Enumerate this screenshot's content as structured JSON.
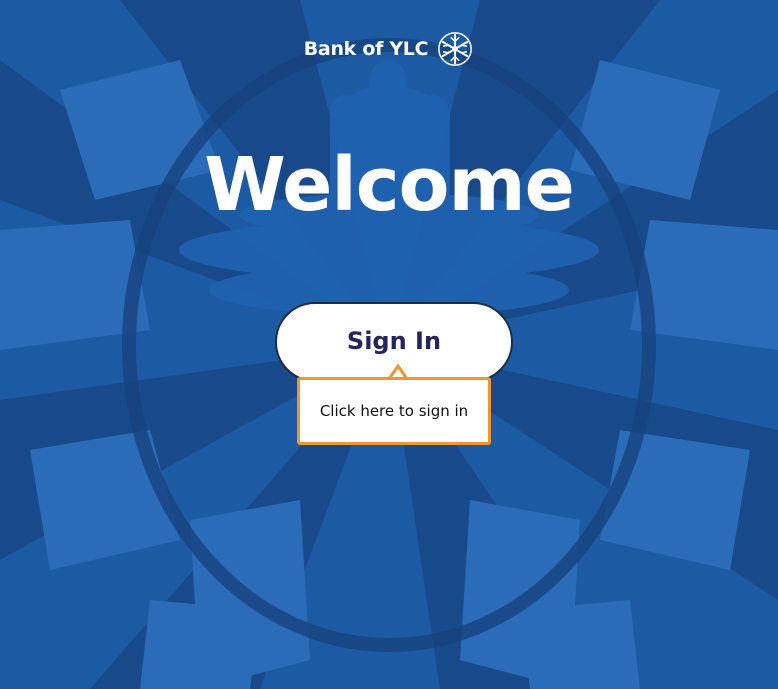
{
  "brand": {
    "name": "Bank of YLC",
    "logo_icon": "snowflake-icon"
  },
  "hero": {
    "title": "Welcome"
  },
  "signin": {
    "button_label": "Sign In"
  },
  "tooltip": {
    "text": "Click here to sign in"
  },
  "colors": {
    "background": "#1c5aa3",
    "background_dark": "#18498a",
    "background_light": "#2a6cb8",
    "button_text": "#23255c",
    "tooltip_border": "#f0962e"
  }
}
